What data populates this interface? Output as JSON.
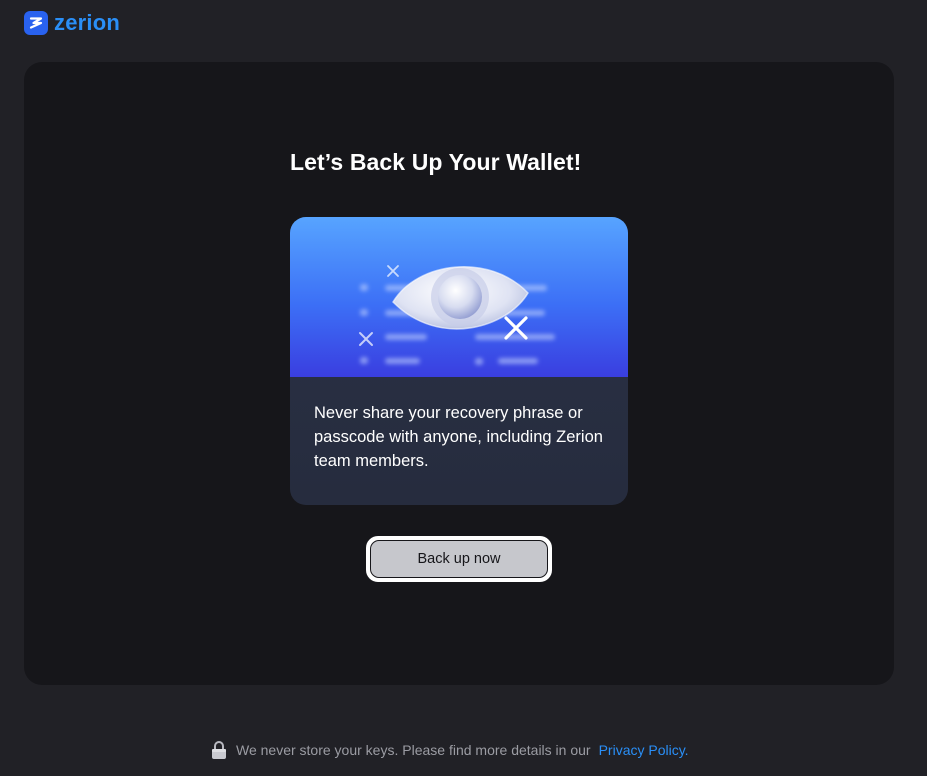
{
  "header": {
    "logo_icon": "zerion-logo-icon",
    "logo_text": "zerion",
    "brand_color": "#2a8ff7"
  },
  "main": {
    "title": "Let’s Back Up Your Wallet!",
    "card": {
      "illustration": "eye-illustration",
      "text": "Never share your recovery phrase or passcode with anyone, including Zerion team members."
    },
    "backup_button_label": "Back up now"
  },
  "footer": {
    "lock_icon": "lock-icon",
    "notice": "We never store your keys. Please find more details in our",
    "link_label": "Privacy Policy."
  }
}
